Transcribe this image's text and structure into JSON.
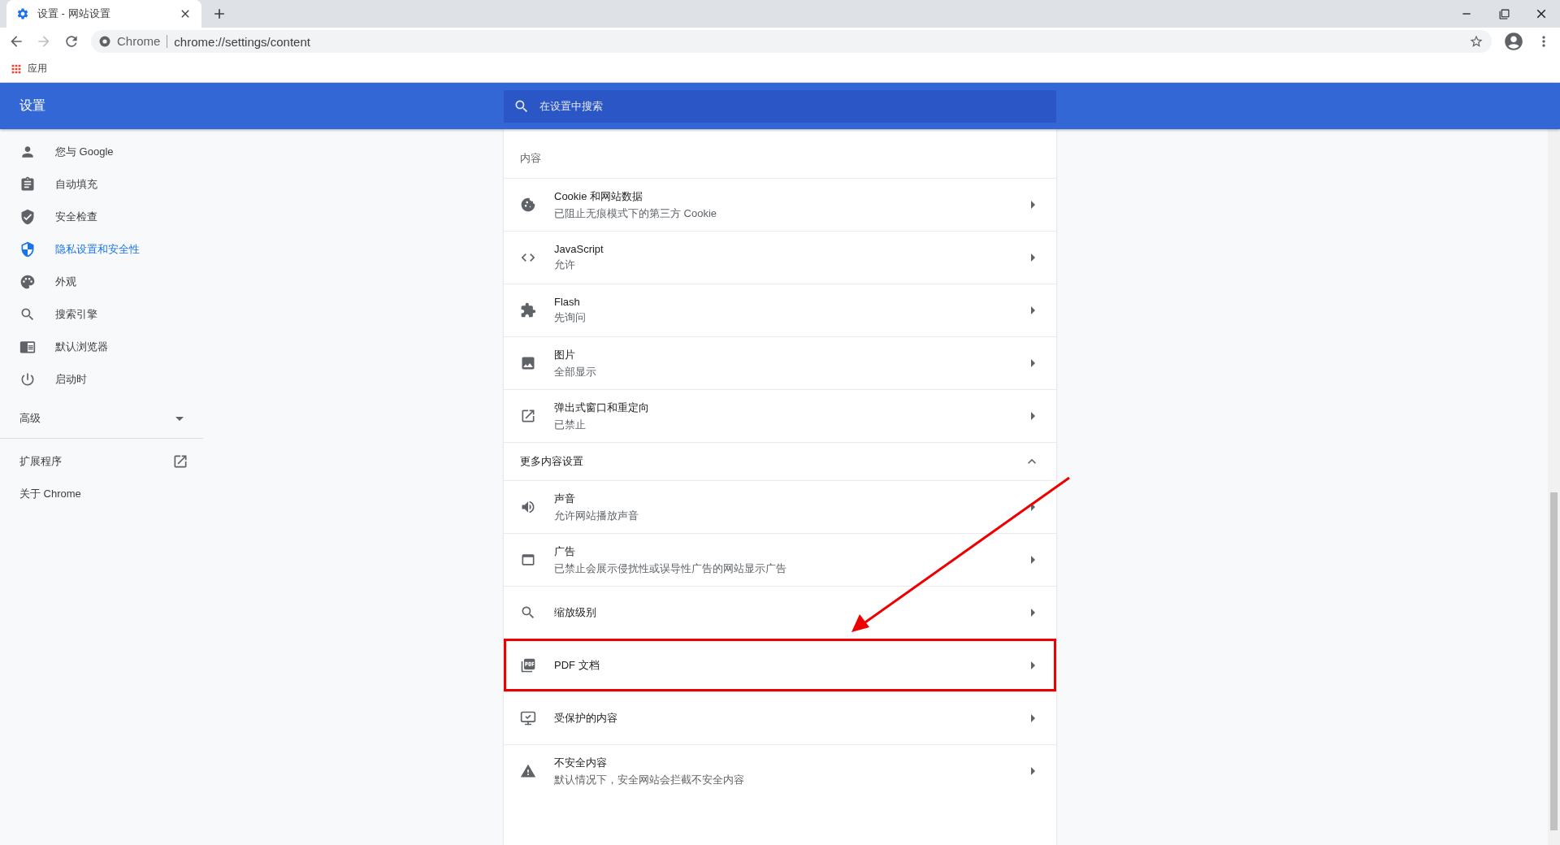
{
  "browser": {
    "tab": {
      "title": "设置 - 网站设置"
    },
    "address": {
      "scheme": "Chrome",
      "url": "chrome://settings/content"
    },
    "bookmarks": [
      {
        "label": "应用"
      }
    ]
  },
  "header": {
    "title": "设置",
    "search": {
      "placeholder": "在设置中搜索"
    }
  },
  "sidebar": {
    "items": [
      {
        "label": "您与 Google",
        "selected": false
      },
      {
        "label": "自动填充",
        "selected": false
      },
      {
        "label": "安全检查",
        "selected": false
      },
      {
        "label": "隐私设置和安全性",
        "selected": true
      },
      {
        "label": "外观",
        "selected": false
      },
      {
        "label": "搜索引擎",
        "selected": false
      },
      {
        "label": "默认浏览器",
        "selected": false
      },
      {
        "label": "启动时",
        "selected": false
      }
    ],
    "advanced": {
      "label": "高级",
      "expanded": false
    },
    "links": [
      {
        "label": "扩展程序",
        "external": true
      },
      {
        "label": "关于 Chrome",
        "external": false
      }
    ]
  },
  "content": {
    "section_title": "内容",
    "items": [
      {
        "title": "Cookie 和网站数据",
        "subtitle": "已阻止无痕模式下的第三方 Cookie",
        "highlighted": false
      },
      {
        "title": "JavaScript",
        "subtitle": "允许",
        "highlighted": false
      },
      {
        "title": "Flash",
        "subtitle": "先询问",
        "highlighted": false
      },
      {
        "title": "图片",
        "subtitle": "全部显示",
        "highlighted": false
      },
      {
        "title": "弹出式窗口和重定向",
        "subtitle": "已禁止",
        "highlighted": false
      }
    ],
    "more": {
      "title": "更多内容设置",
      "expanded": true,
      "items": [
        {
          "title": "声音",
          "subtitle": "允许网站播放声音",
          "highlighted": false
        },
        {
          "title": "广告",
          "subtitle": "已禁止会展示侵扰性或误导性广告的网站显示广告",
          "highlighted": false
        },
        {
          "title": "缩放级别",
          "highlighted": false
        },
        {
          "title": "PDF 文档",
          "highlighted": true
        },
        {
          "title": "受保护的内容",
          "highlighted": false
        },
        {
          "title": "不安全内容",
          "subtitle": "默认情况下，安全网站会拦截不安全内容",
          "highlighted": false
        }
      ]
    }
  }
}
